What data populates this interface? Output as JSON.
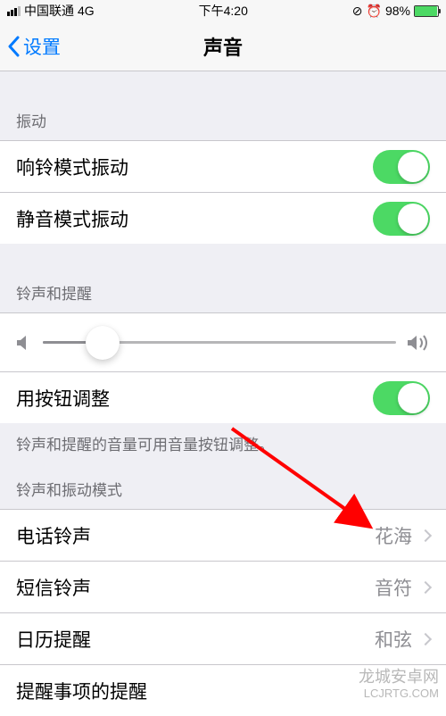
{
  "status": {
    "carrier": "中国联通",
    "network": "4G",
    "time": "下午4:20",
    "battery_pct": "98%"
  },
  "nav": {
    "back_label": "设置",
    "title": "声音"
  },
  "sections": {
    "vibrate": {
      "header": "振动",
      "items": [
        {
          "label": "响铃模式振动",
          "on": true
        },
        {
          "label": "静音模式振动",
          "on": true
        }
      ]
    },
    "ringer": {
      "header": "铃声和提醒",
      "button_adjust_label": "用按钮调整",
      "button_adjust_on": true,
      "footer": "铃声和提醒的音量可用音量按钮调整。",
      "slider_value_pct": 17
    },
    "patterns": {
      "header": "铃声和振动模式",
      "items": [
        {
          "label": "电话铃声",
          "value": "花海"
        },
        {
          "label": "短信铃声",
          "value": "音符"
        },
        {
          "label": "日历提醒",
          "value": "和弦"
        },
        {
          "label": "提醒事项的提醒",
          "value": ""
        }
      ]
    }
  },
  "watermark": {
    "line1": "龙城安卓网",
    "line2": "LCJRTG.COM"
  }
}
